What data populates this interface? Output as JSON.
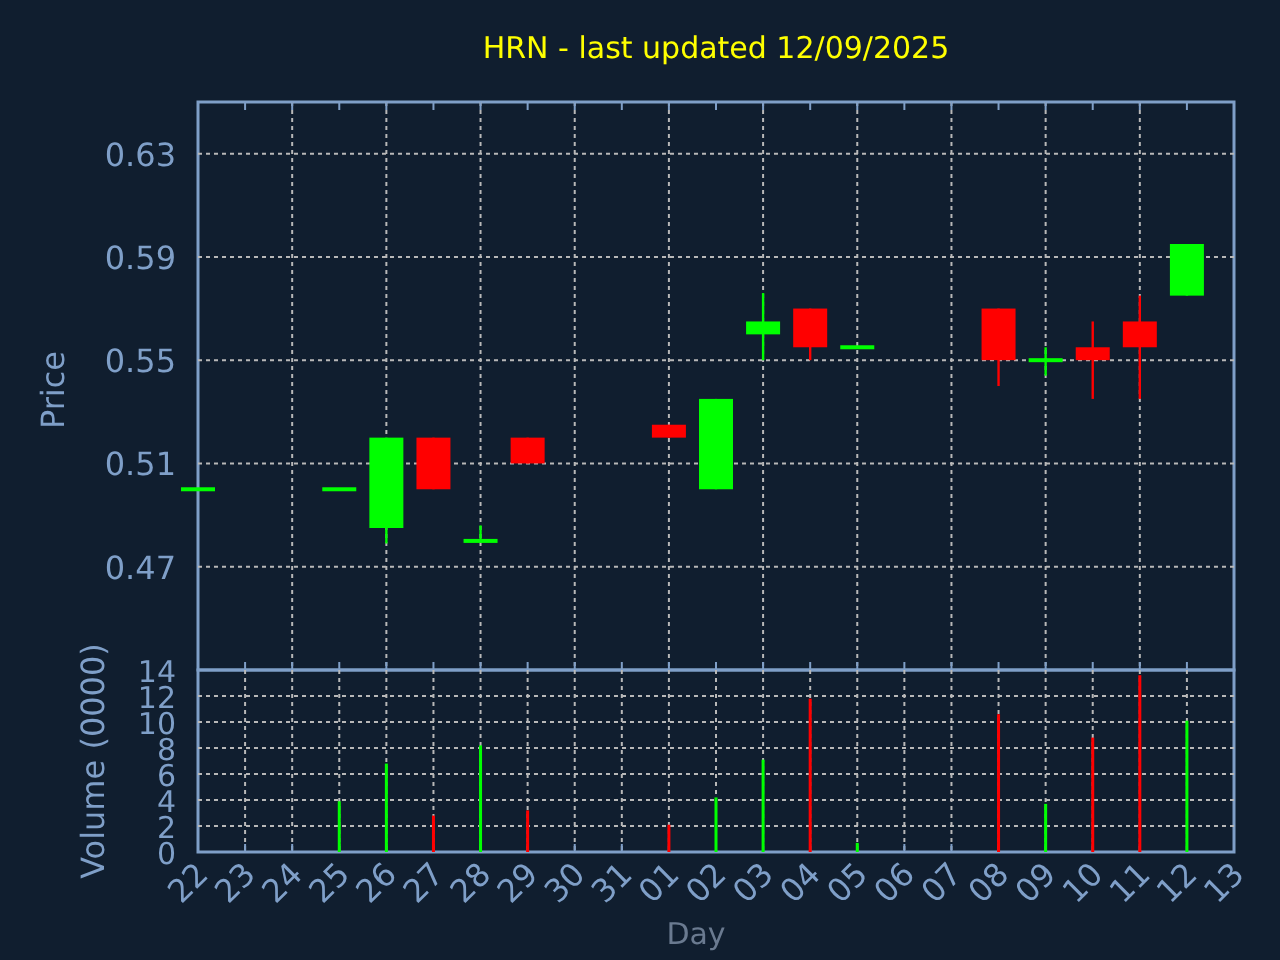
{
  "title": "HRN - last updated 12/09/2025",
  "price_chart": {
    "chart_data": {
      "type": "candlestick",
      "ylabel": "Price",
      "grid": true,
      "ylim": [
        0.43,
        0.65
      ],
      "yticks": [
        0.47,
        0.51,
        0.55,
        0.59,
        0.63
      ],
      "categories": [
        null,
        null,
        null,
        null,
        null,
        null,
        null,
        null,
        null,
        null,
        null,
        null,
        null,
        null,
        null,
        null,
        null,
        null,
        null,
        null,
        null,
        null,
        null
      ],
      "series": [
        {
          "ohlc": [
            [
              0.5,
              0.5,
              0.5,
              0.5
            ],
            null,
            null,
            [
              0.5,
              0.5,
              0.5,
              0.5
            ],
            [
              0.485,
              0.52,
              0.479,
              0.52
            ],
            [
              0.52,
              0.52,
              0.5,
              0.5
            ],
            [
              0.48,
              0.486,
              0.48,
              0.48
            ],
            [
              0.52,
              0.52,
              0.51,
              0.51
            ],
            null,
            null,
            [
              0.525,
              0.525,
              0.52,
              0.52
            ],
            [
              0.5,
              0.535,
              0.5,
              0.535
            ],
            [
              0.56,
              0.576,
              0.55,
              0.565
            ],
            [
              0.57,
              0.57,
              0.55,
              0.555
            ],
            [
              0.555,
              0.555,
              0.555,
              0.555
            ],
            null,
            null,
            [
              0.57,
              0.57,
              0.54,
              0.55
            ],
            [
              0.55,
              0.555,
              0.544,
              0.55
            ],
            [
              0.555,
              0.565,
              0.535,
              0.55
            ],
            [
              0.565,
              0.575,
              0.535,
              0.555
            ],
            [
              0.575,
              0.595,
              0.575,
              0.595
            ],
            null
          ]
        }
      ]
    }
  },
  "volume_chart": {
    "chart_data": {
      "type": "bar",
      "grid": true,
      "xlabel": "Day",
      "ylabel": "Volume (0000)",
      "categories": [
        "22",
        "23",
        "24",
        "25",
        "26",
        "27",
        "28",
        "29",
        "30",
        "31",
        "01",
        "02",
        "03",
        "04",
        "05",
        "06",
        "07",
        "08",
        "09",
        "10",
        "11",
        "12",
        "13"
      ],
      "ylim": [
        0,
        14
      ],
      "yticks": [
        0,
        2,
        4,
        6,
        8,
        10,
        12,
        14
      ],
      "series": [
        {
          "color": "#00ff00",
          "values": [
            null,
            null,
            null,
            3.9,
            6.8,
            null,
            8.2,
            null,
            null,
            null,
            null,
            4.2,
            7.1,
            null,
            0.7,
            null,
            null,
            null,
            3.7,
            null,
            null,
            10.1,
            null
          ]
        },
        {
          "color": "#ff0000",
          "values": [
            null,
            null,
            null,
            null,
            null,
            2.8,
            null,
            3.2,
            null,
            null,
            2.1,
            null,
            null,
            11.8,
            null,
            null,
            null,
            10.6,
            null,
            8.8,
            13.6,
            null,
            null
          ]
        }
      ]
    }
  }
}
